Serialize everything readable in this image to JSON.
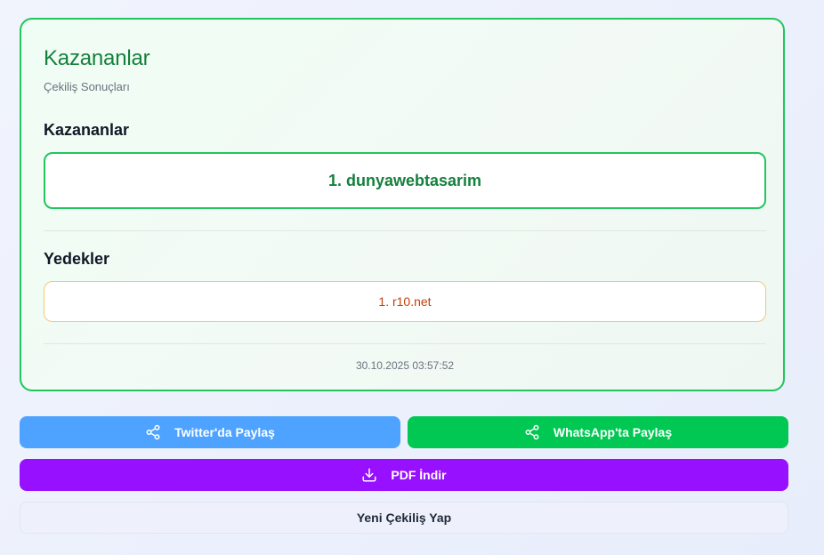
{
  "card": {
    "title": "Kazananlar",
    "subtitle": "Çekiliş Sonuçları",
    "winners_heading": "Kazananlar",
    "winners": [
      "1. dunyawebtasarim"
    ],
    "backups_heading": "Yedekler",
    "backups": [
      "1. r10.net"
    ],
    "timestamp": "30.10.2025 03:57:52"
  },
  "actions": {
    "twitter_label": "Twitter'da Paylaş",
    "whatsapp_label": "WhatsApp'ta Paylaş",
    "pdf_label": "PDF İndir",
    "new_draw_label": "Yeni Çekiliş Yap"
  },
  "icons": {
    "twitter": "share-icon",
    "whatsapp": "share-icon",
    "pdf": "download-icon"
  },
  "colors": {
    "accent_green": "#22c55e",
    "title_green": "#15803d",
    "backup_text": "#c2410c",
    "twitter_button": "#4da3ff",
    "whatsapp_button": "#00c853",
    "pdf_button": "#9710ff"
  }
}
